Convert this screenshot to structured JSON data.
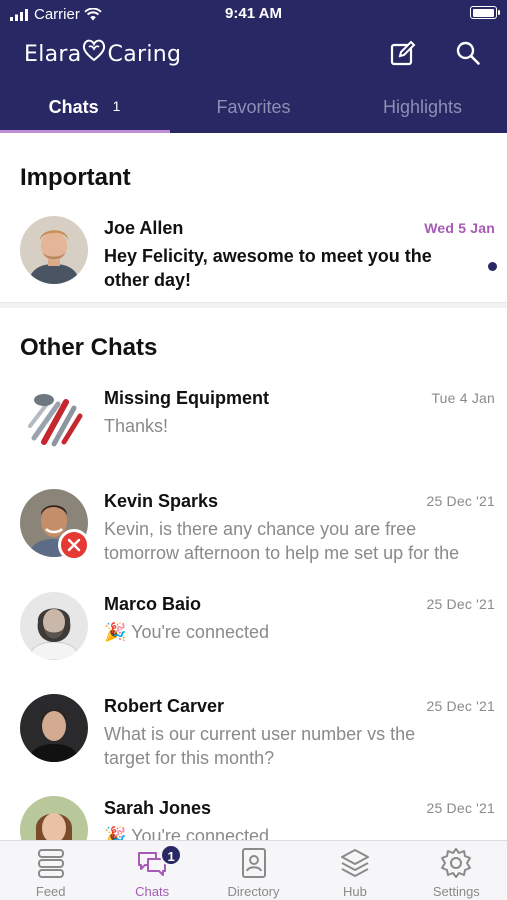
{
  "status_bar": {
    "carrier": "Carrier",
    "time": "9:41 AM",
    "battery_level": 1.0
  },
  "brand": {
    "left": "Elara",
    "right": "Caring"
  },
  "header_icons": [
    "compose-icon",
    "search-icon"
  ],
  "tabs": [
    {
      "label": "Chats",
      "count": "1",
      "active": true
    },
    {
      "label": "Favorites",
      "active": false
    },
    {
      "label": "Highlights",
      "active": false
    }
  ],
  "important": {
    "title": "Important",
    "chats": [
      {
        "name": "Joe Allen",
        "date": "Wed 5 Jan",
        "message": "Hey Felicity, awesome to meet you the other day!",
        "unread": true
      }
    ]
  },
  "other": {
    "title": "Other Chats",
    "chats": [
      {
        "name": "Missing Equipment",
        "date": "Tue 4 Jan",
        "message": "Thanks!"
      },
      {
        "name": "Kevin Sparks",
        "date": "25 Dec '21",
        "message": "Kevin, is there any chance you are free tomorrow afternoon to help me set up for the",
        "failed": true
      },
      {
        "name": "Marco Baio",
        "date": "25 Dec '21",
        "emoji": "🎉",
        "message": "You're connected"
      },
      {
        "name": "Robert Carver",
        "date": "25 Dec '21",
        "message": "What is our current user number vs the target for this month?"
      },
      {
        "name": "Sarah Jones",
        "date": "25 Dec '21",
        "emoji": "🎉",
        "message": "You're connected"
      }
    ]
  },
  "bottom_nav": [
    {
      "label": "Feed",
      "icon": "feed-icon"
    },
    {
      "label": "Chats",
      "icon": "chats-icon",
      "badge": "1",
      "active": true
    },
    {
      "label": "Directory",
      "icon": "directory-icon"
    },
    {
      "label": "Hub",
      "icon": "hub-icon"
    },
    {
      "label": "Settings",
      "icon": "settings-icon"
    }
  ],
  "colors": {
    "header": "#272864",
    "accent": "#a65ab6",
    "tab_underline": "#c18ed9",
    "error": "#e53935"
  }
}
